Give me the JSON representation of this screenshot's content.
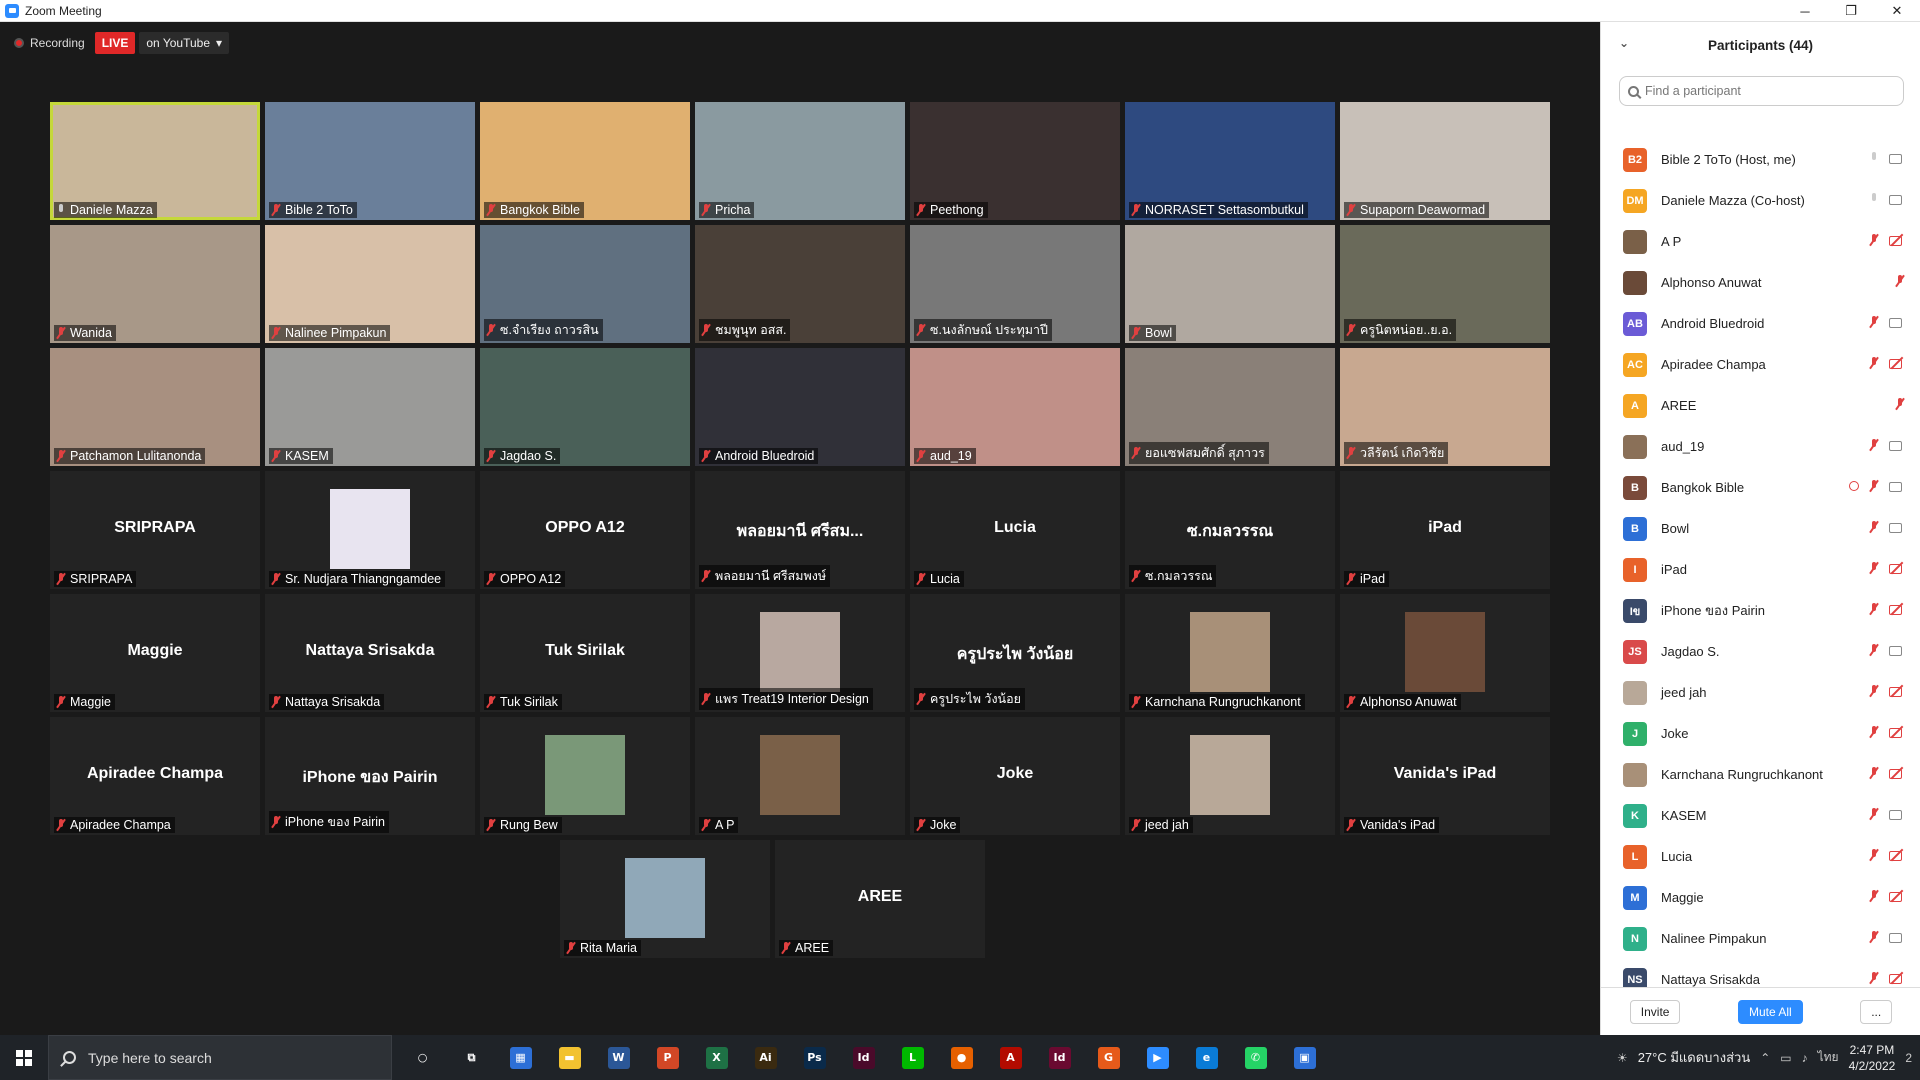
{
  "window": {
    "title": "Zoom Meeting",
    "minimize": "─",
    "maximize": "❐",
    "close": "✕"
  },
  "recording": {
    "label": "Recording",
    "live": "LIVE",
    "destination": "on YouTube",
    "caret": "▾"
  },
  "tiles": [
    [
      {
        "name": "Daniele Mazza",
        "type": "video",
        "mic": "on",
        "active": true,
        "color": "#c9b79a"
      },
      {
        "name": "Bible 2 ToTo",
        "type": "video",
        "mic": "muted",
        "color": "#6a7f9a"
      },
      {
        "name": "Bangkok Bible",
        "type": "video",
        "mic": "muted",
        "color": "#e0b070"
      },
      {
        "name": "Pricha",
        "type": "video",
        "mic": "muted",
        "color": "#8a9aa0"
      },
      {
        "name": "Peethong",
        "type": "video",
        "mic": "muted",
        "color": "#3a3030"
      },
      {
        "name": "NORRASET Settasombutkul",
        "type": "video",
        "mic": "muted",
        "color": "#2e4a80"
      },
      {
        "name": "Supaporn Deawormad",
        "type": "video",
        "mic": "muted",
        "color": "#c8c0b8"
      }
    ],
    [
      {
        "name": "Wanida",
        "type": "video",
        "mic": "muted",
        "color": "#a89888"
      },
      {
        "name": "Nalinee Pimpakun",
        "type": "video",
        "mic": "muted",
        "color": "#d8c0a8"
      },
      {
        "name": "ซ.จำเรียง ถาวรสิน",
        "type": "video",
        "mic": "muted",
        "color": "#607080"
      },
      {
        "name": "ชมพูนุท อสส.",
        "type": "video",
        "mic": "muted",
        "color": "#4a4038"
      },
      {
        "name": "ซ.นงลักษณ์ ประทุมาปี",
        "type": "video",
        "mic": "muted",
        "color": "#787878"
      },
      {
        "name": "Bowl",
        "type": "video",
        "mic": "muted",
        "color": "#b0a8a0"
      },
      {
        "name": "ครูนิตหน่อย..ย.อ.",
        "type": "video",
        "mic": "muted",
        "color": "#6a6a5a"
      }
    ],
    [
      {
        "name": "Patchamon Lulitanonda",
        "type": "video",
        "mic": "muted",
        "color": "#a89080"
      },
      {
        "name": "KASEM",
        "type": "video",
        "mic": "muted",
        "color": "#9a9a98"
      },
      {
        "name": "Jagdao S.",
        "type": "video",
        "mic": "muted",
        "color": "#4a6058"
      },
      {
        "name": "Android Bluedroid",
        "type": "video",
        "mic": "muted",
        "color": "#303038"
      },
      {
        "name": "aud_19",
        "type": "video",
        "mic": "muted",
        "color": "#c09088"
      },
      {
        "name": "ยอแซฟสมศักดิ์ สุภาวร",
        "type": "video",
        "mic": "muted",
        "color": "#8a8078"
      },
      {
        "name": "วลีรัตน์ เกิดวิชัย",
        "type": "video",
        "mic": "muted",
        "color": "#c8a890"
      }
    ],
    [
      {
        "name": "SRIPRAPA",
        "type": "name",
        "center": "SRIPRAPA",
        "mic": "muted"
      },
      {
        "name": "Sr. Nudjara Thiangngamdee",
        "type": "photo",
        "mic": "muted",
        "color": "#e8e4f0"
      },
      {
        "name": "OPPO A12",
        "type": "name",
        "center": "OPPO A12",
        "mic": "muted"
      },
      {
        "name": "พลอยมานี ศรีสมพงษ์",
        "type": "name",
        "center": "พลอยมานี ศรีสม...",
        "mic": "muted"
      },
      {
        "name": "Lucia",
        "type": "name",
        "center": "Lucia",
        "mic": "muted"
      },
      {
        "name": "ซ.กมลวรรณ",
        "type": "name",
        "center": "ซ.กมลวรรณ",
        "mic": "muted"
      },
      {
        "name": "iPad",
        "type": "name",
        "center": "iPad",
        "mic": "muted"
      }
    ],
    [
      {
        "name": "Maggie",
        "type": "name",
        "center": "Maggie",
        "mic": "muted"
      },
      {
        "name": "Nattaya Srisakda",
        "type": "name",
        "center": "Nattaya Srisakda",
        "mic": "muted"
      },
      {
        "name": "Tuk Sirilak",
        "type": "name",
        "center": "Tuk Sirilak",
        "mic": "muted"
      },
      {
        "name": "แพร Treat19 Interior Design",
        "type": "photo",
        "mic": "muted",
        "color": "#b8a8a0"
      },
      {
        "name": "ครูประไพ วังน้อย",
        "type": "name",
        "center": "ครูประไพ วังน้อย",
        "mic": "muted"
      },
      {
        "name": "Karnchana Rungruchkanont",
        "type": "photo",
        "mic": "muted",
        "color": "#a89078"
      },
      {
        "name": "Alphonso Anuwat",
        "type": "photo",
        "mic": "muted",
        "color": "#6a4a38"
      }
    ],
    [
      {
        "name": "Apiradee Champa",
        "type": "name",
        "center": "Apiradee Champa",
        "mic": "muted"
      },
      {
        "name": "iPhone ของ Pairin",
        "type": "name",
        "center": "iPhone ของ Pairin",
        "mic": "muted"
      },
      {
        "name": "Rung Bew",
        "type": "photo",
        "mic": "muted",
        "color": "#7a9878"
      },
      {
        "name": "A P",
        "type": "photo",
        "mic": "muted",
        "color": "#7a6048"
      },
      {
        "name": "Joke",
        "type": "name",
        "center": "Joke",
        "mic": "muted"
      },
      {
        "name": "jeed jah",
        "type": "photo",
        "mic": "muted",
        "color": "#b8a898"
      },
      {
        "name": "Vanida's iPad",
        "type": "name",
        "center": "Vanida's iPad",
        "mic": "muted"
      }
    ],
    [
      {
        "name": "Rita Maria",
        "type": "photo",
        "mic": "muted",
        "color": "#90a8b8"
      },
      {
        "name": "AREE",
        "type": "name",
        "center": "AREE",
        "mic": "muted"
      }
    ]
  ],
  "participants": {
    "title": "Participants (44)",
    "search_placeholder": "Find a participant",
    "list": [
      {
        "initials": "B2",
        "name": "Bible 2 ToTo (Host, me)",
        "color": "#e8622a",
        "mic": "on",
        "cam": "on"
      },
      {
        "initials": "DM",
        "name": "Daniele Mazza (Co-host)",
        "color": "#f5a623",
        "mic": "on",
        "cam": "on"
      },
      {
        "initials": "",
        "name": "A P",
        "color": "#7a6048",
        "mic": "muted",
        "cam": "off"
      },
      {
        "initials": "",
        "name": "Alphonso Anuwat",
        "color": "#6a4a38",
        "mic": "muted",
        "cam": "none"
      },
      {
        "initials": "AB",
        "name": "Android Bluedroid",
        "color": "#6b5bd6",
        "mic": "muted",
        "cam": "on"
      },
      {
        "initials": "AC",
        "name": "Apiradee Champa",
        "color": "#f5a623",
        "mic": "muted",
        "cam": "off"
      },
      {
        "initials": "A",
        "name": "AREE",
        "color": "#f5a623",
        "mic": "muted",
        "cam": "none"
      },
      {
        "initials": "",
        "name": "aud_19",
        "color": "#8a7058",
        "mic": "muted",
        "cam": "on"
      },
      {
        "initials": "B",
        "name": "Bangkok Bible",
        "color": "#7a4a3a",
        "mic": "muted",
        "cam": "on",
        "recording": true
      },
      {
        "initials": "B",
        "name": "Bowl",
        "color": "#2d6fd6",
        "mic": "muted",
        "cam": "on"
      },
      {
        "initials": "I",
        "name": "iPad",
        "color": "#e8622a",
        "mic": "muted",
        "cam": "off"
      },
      {
        "initials": "Iข",
        "name": "iPhone ของ Pairin",
        "color": "#3a4a6a",
        "mic": "muted",
        "cam": "off"
      },
      {
        "initials": "JS",
        "name": "Jagdao S.",
        "color": "#d94a4a",
        "mic": "muted",
        "cam": "on"
      },
      {
        "initials": "",
        "name": "jeed jah",
        "color": "#b8a898",
        "mic": "muted",
        "cam": "off"
      },
      {
        "initials": "J",
        "name": "Joke",
        "color": "#2fb06a",
        "mic": "muted",
        "cam": "off"
      },
      {
        "initials": "",
        "name": "Karnchana Rungruchkanont",
        "color": "#a89078",
        "mic": "muted",
        "cam": "off"
      },
      {
        "initials": "K",
        "name": "KASEM",
        "color": "#2fb08a",
        "mic": "muted",
        "cam": "on"
      },
      {
        "initials": "L",
        "name": "Lucia",
        "color": "#e8622a",
        "mic": "muted",
        "cam": "off"
      },
      {
        "initials": "M",
        "name": "Maggie",
        "color": "#2d6fd6",
        "mic": "muted",
        "cam": "off"
      },
      {
        "initials": "N",
        "name": "Nalinee Pimpakun",
        "color": "#2fb08a",
        "mic": "muted",
        "cam": "on"
      },
      {
        "initials": "NS",
        "name": "Nattaya Srisakda",
        "color": "#3a4a6a",
        "mic": "muted",
        "cam": "off"
      }
    ],
    "invite": "Invite",
    "mute_all": "Mute All",
    "more": "..."
  },
  "taskbar": {
    "search_placeholder": "Type here to search",
    "apps": [
      {
        "icon": "cortana-icon",
        "glyph": "○",
        "color": "transparent"
      },
      {
        "icon": "task-view-icon",
        "glyph": "⧉",
        "color": "transparent"
      },
      {
        "icon": "calculator-icon",
        "glyph": "▦",
        "color": "#2d6fd6"
      },
      {
        "icon": "file-explorer-icon",
        "glyph": "▬",
        "color": "#f2c230"
      },
      {
        "icon": "word-icon",
        "glyph": "W",
        "color": "#2b5797"
      },
      {
        "icon": "powerpoint-icon",
        "glyph": "P",
        "color": "#d24726"
      },
      {
        "icon": "excel-icon",
        "glyph": "X",
        "color": "#1e7145"
      },
      {
        "icon": "illustrator-icon",
        "glyph": "Ai",
        "color": "#3a2a10"
      },
      {
        "icon": "photoshop-icon",
        "glyph": "Ps",
        "color": "#0a2a4a"
      },
      {
        "icon": "indesign-icon",
        "glyph": "Id",
        "color": "#4a0a2a"
      },
      {
        "icon": "line-icon",
        "glyph": "L",
        "color": "#00b900"
      },
      {
        "icon": "firefox-icon",
        "glyph": "●",
        "color": "#e66000"
      },
      {
        "icon": "acrobat-icon",
        "glyph": "A",
        "color": "#b30b00"
      },
      {
        "icon": "indesign2-icon",
        "glyph": "Id",
        "color": "#6a0a30"
      },
      {
        "icon": "grammarly-icon",
        "glyph": "G",
        "color": "#e65a1a"
      },
      {
        "icon": "zoom-icon",
        "glyph": "▶",
        "color": "#2d8cff"
      },
      {
        "icon": "edge-icon",
        "glyph": "e",
        "color": "#0a7bd6"
      },
      {
        "icon": "whatsapp-icon",
        "glyph": "✆",
        "color": "#25d366"
      },
      {
        "icon": "snip-icon",
        "glyph": "▣",
        "color": "#2d6fd6"
      }
    ],
    "weather": "27°C มีแดดบางส่วน",
    "lang": "ไทย",
    "time": "2:47 PM",
    "date": "4/2/2022",
    "notif_count": "2"
  }
}
